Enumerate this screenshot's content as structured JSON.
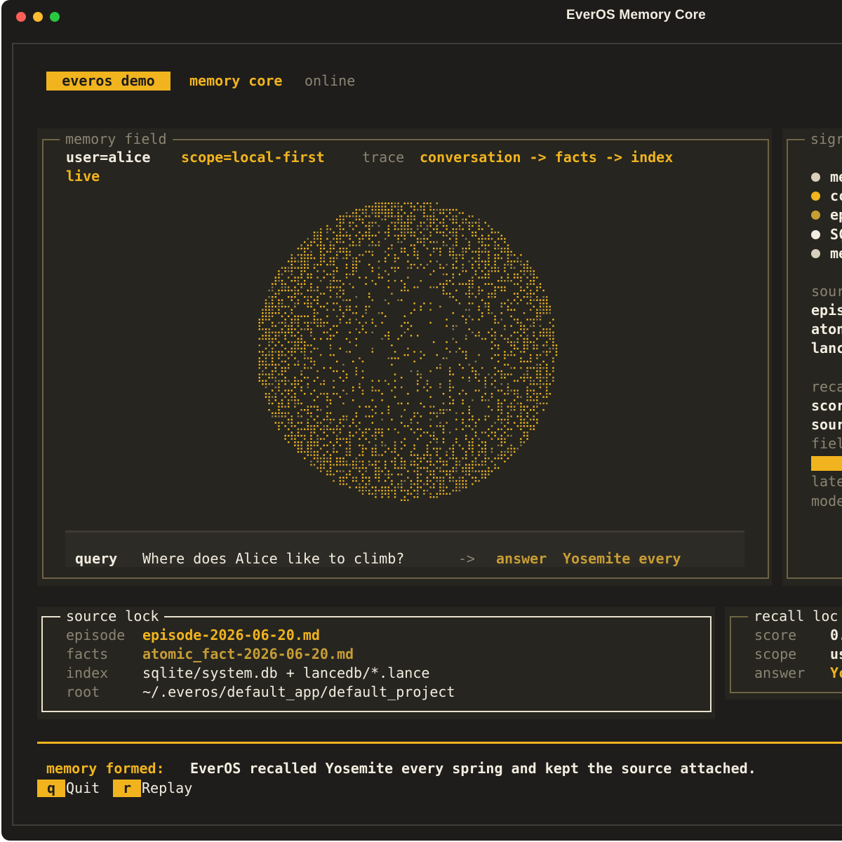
{
  "window": {
    "title": "EverOS Memory Core"
  },
  "header": {
    "badge": "everos demo",
    "status_strong": "memory core",
    "status_rest": "online"
  },
  "memory_field": {
    "legend": "memory field",
    "user": "user=alice",
    "scope": "scope=local-first",
    "trace_label": "trace",
    "trace_value": "conversation -> facts -> index",
    "live": "live",
    "query_label": "query",
    "query_text": "Where does Alice like to climb?",
    "arrow": "->",
    "answer_label": "answer",
    "answer_text": "Yosemite every"
  },
  "signal_panel": {
    "legend": "sigr",
    "bullets": [
      "me",
      "cc",
      "ep",
      "SÇ",
      "me"
    ],
    "bullet_colors": [
      "#d8d0bb",
      "#f1b41e",
      "#c79d35",
      "#f2ede0",
      "#d8d0bb"
    ],
    "section1": [
      "sour",
      "epis",
      "aton",
      "lanc"
    ],
    "section2": [
      "reca",
      "scor",
      "sour",
      "fiel"
    ],
    "section3": [
      "late",
      "mode"
    ]
  },
  "source_lock": {
    "legend": "source lock",
    "rows": [
      {
        "key": "episode",
        "value": "episode-2026-06-20.md"
      },
      {
        "key": "facts",
        "value": "atomic_fact-2026-06-20.md"
      },
      {
        "key": "index",
        "value": "sqlite/system.db + lancedb/*.lance"
      },
      {
        "key": "root",
        "value": "~/.everos/default_app/default_project"
      }
    ]
  },
  "recall_lock": {
    "legend": "recall loc",
    "rows": [
      {
        "key": "score",
        "value": "0."
      },
      {
        "key": "scope",
        "value": "us"
      },
      {
        "key": "answer",
        "value": "Yc"
      }
    ]
  },
  "status": {
    "label": "memory formed:",
    "message": "EverOS recalled Yosemite every spring and kept the source attached."
  },
  "keys": [
    {
      "key": "q",
      "label": "Quit"
    },
    {
      "key": "r",
      "label": "Replay"
    }
  ],
  "colors": {
    "accent": "#f1b41e",
    "accent_dim": "#c79d35",
    "background": "#1d1c1a",
    "text": "#f2ede0",
    "muted": "#8a8473"
  }
}
